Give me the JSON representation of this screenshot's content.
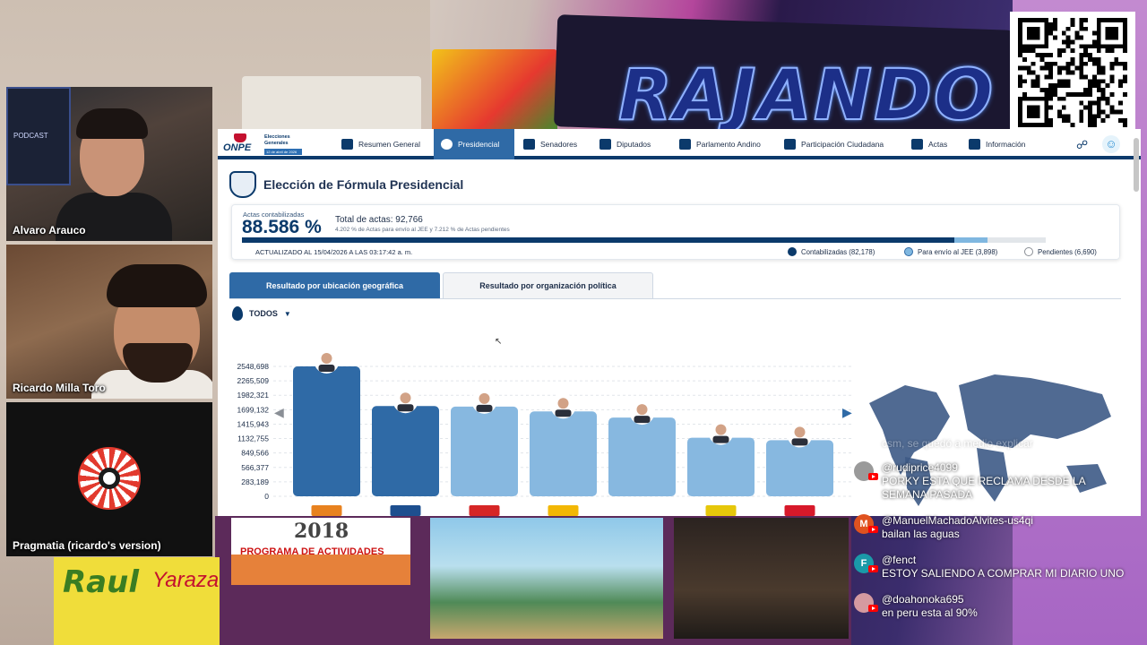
{
  "stream": {
    "background_text": "RAJANDO",
    "poster_left_2018": "2018",
    "poster_left_2018_caption": "PROGRAMA DE ACTIVIDADES",
    "poster_bottom_left": "Raul",
    "poster_bottom_left_2": "Yaraza"
  },
  "participants": [
    {
      "name": "Alvaro Arauco"
    },
    {
      "name": "Ricardo Milla Toro"
    },
    {
      "name": "Pragmatia (ricardo's version)"
    }
  ],
  "onpe": {
    "logo_text": "ONPE",
    "logo_sub": "Elecciones Generales",
    "logo_date": "12 de abril de 2026",
    "nav": [
      {
        "label": "Resumen General",
        "icon": "grid-icon"
      },
      {
        "label": "Presidencial",
        "icon": "shield-icon",
        "active": true
      },
      {
        "label": "Senadores",
        "icon": "people-icon"
      },
      {
        "label": "Diputados",
        "icon": "building-icon"
      },
      {
        "label": "Parlamento Andino",
        "icon": "globe-icon"
      },
      {
        "label": "Participación Ciudadana",
        "icon": "group-icon"
      },
      {
        "label": "Actas",
        "icon": "check-icon"
      },
      {
        "label": "Información",
        "icon": "doc-icon"
      }
    ],
    "page_title": "Elección de Fórmula Presidencial",
    "stats": {
      "label": "Actas contabilizadas",
      "percent": "88.586 %",
      "total": "Total de actas: 92,766",
      "sub": "4.202 % de Actas para envío al JEE y 7.212 % de Actas pendientes",
      "updated": "ACTUALIZADO AL 15/04/2026 A LAS 03:17:42 a. m.",
      "progress": {
        "contabilizadas": 0.88586,
        "jee": 0.04202
      },
      "legend": [
        {
          "label": "Contabilizadas (82,178)",
          "color": "#0b3a6b"
        },
        {
          "label": "Para envío al JEE (3,898)",
          "color": "#7fb7e0"
        },
        {
          "label": "Pendientes (6,690)",
          "color": "#ffffff"
        }
      ]
    },
    "tabs": [
      {
        "label": "Resultado por ubicación geográfica",
        "active": true
      },
      {
        "label": "Resultado por organización política",
        "active": false
      }
    ],
    "filter": "TODOS"
  },
  "chart_data": {
    "type": "bar",
    "ylim": [
      0,
      2548698
    ],
    "yticks": [
      "2548,698",
      "2265,509",
      "1982,321",
      "1699,132",
      "1415,943",
      "1132,755",
      "849,566",
      "566,377",
      "283,189",
      "0"
    ],
    "values": [
      2548698,
      1771000,
      1760000,
      1665000,
      1545000,
      1150000,
      1100000
    ],
    "colors": [
      "#2f6aa6",
      "#2f6aa6",
      "#87b8e0",
      "#87b8e0",
      "#87b8e0",
      "#87b8e0",
      "#87b8e0"
    ],
    "party_colors": [
      "#e8821f",
      "#1d4f8f",
      "#d62626",
      "#f2b705",
      "#ffffff",
      "#e6c70a",
      "#d7192a"
    ]
  },
  "chat": [
    {
      "user": "",
      "text": "csm, se quedó a medio explicar",
      "faded": true,
      "avatar": "",
      "avatar_color": "#c8c8c8"
    },
    {
      "user": "@rudiprice4099",
      "text": "PORKY ESTA QUE RECLAMA DESDE LA SEMANA PASADA",
      "avatar": "",
      "avatar_color": "#9a9a9a"
    },
    {
      "user": "@ManuelMachadoAlvites-us4qi",
      "text": "bailan las aguas",
      "avatar": "M",
      "avatar_color": "#e0521f"
    },
    {
      "user": "@fenct",
      "text": "ESTOY SALIENDO A COMPRAR MI DIARIO UNO",
      "avatar": "F",
      "avatar_color": "#1a9aa8"
    },
    {
      "user": "@doahonoka695",
      "text": "en peru esta al 90%",
      "avatar": "",
      "avatar_color": "#d59aa0"
    }
  ]
}
